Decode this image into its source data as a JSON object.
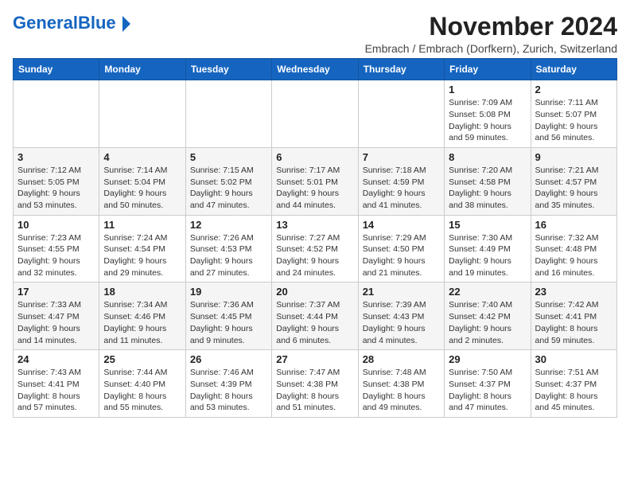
{
  "header": {
    "logo_general": "General",
    "logo_blue": "Blue",
    "title": "November 2024",
    "subtitle": "Embrach / Embrach (Dorfkern), Zurich, Switzerland"
  },
  "weekdays": [
    "Sunday",
    "Monday",
    "Tuesday",
    "Wednesday",
    "Thursday",
    "Friday",
    "Saturday"
  ],
  "weeks": [
    [
      {
        "day": "",
        "info": ""
      },
      {
        "day": "",
        "info": ""
      },
      {
        "day": "",
        "info": ""
      },
      {
        "day": "",
        "info": ""
      },
      {
        "day": "",
        "info": ""
      },
      {
        "day": "1",
        "info": "Sunrise: 7:09 AM\nSunset: 5:08 PM\nDaylight: 9 hours and 59 minutes."
      },
      {
        "day": "2",
        "info": "Sunrise: 7:11 AM\nSunset: 5:07 PM\nDaylight: 9 hours and 56 minutes."
      }
    ],
    [
      {
        "day": "3",
        "info": "Sunrise: 7:12 AM\nSunset: 5:05 PM\nDaylight: 9 hours and 53 minutes."
      },
      {
        "day": "4",
        "info": "Sunrise: 7:14 AM\nSunset: 5:04 PM\nDaylight: 9 hours and 50 minutes."
      },
      {
        "day": "5",
        "info": "Sunrise: 7:15 AM\nSunset: 5:02 PM\nDaylight: 9 hours and 47 minutes."
      },
      {
        "day": "6",
        "info": "Sunrise: 7:17 AM\nSunset: 5:01 PM\nDaylight: 9 hours and 44 minutes."
      },
      {
        "day": "7",
        "info": "Sunrise: 7:18 AM\nSunset: 4:59 PM\nDaylight: 9 hours and 41 minutes."
      },
      {
        "day": "8",
        "info": "Sunrise: 7:20 AM\nSunset: 4:58 PM\nDaylight: 9 hours and 38 minutes."
      },
      {
        "day": "9",
        "info": "Sunrise: 7:21 AM\nSunset: 4:57 PM\nDaylight: 9 hours and 35 minutes."
      }
    ],
    [
      {
        "day": "10",
        "info": "Sunrise: 7:23 AM\nSunset: 4:55 PM\nDaylight: 9 hours and 32 minutes."
      },
      {
        "day": "11",
        "info": "Sunrise: 7:24 AM\nSunset: 4:54 PM\nDaylight: 9 hours and 29 minutes."
      },
      {
        "day": "12",
        "info": "Sunrise: 7:26 AM\nSunset: 4:53 PM\nDaylight: 9 hours and 27 minutes."
      },
      {
        "day": "13",
        "info": "Sunrise: 7:27 AM\nSunset: 4:52 PM\nDaylight: 9 hours and 24 minutes."
      },
      {
        "day": "14",
        "info": "Sunrise: 7:29 AM\nSunset: 4:50 PM\nDaylight: 9 hours and 21 minutes."
      },
      {
        "day": "15",
        "info": "Sunrise: 7:30 AM\nSunset: 4:49 PM\nDaylight: 9 hours and 19 minutes."
      },
      {
        "day": "16",
        "info": "Sunrise: 7:32 AM\nSunset: 4:48 PM\nDaylight: 9 hours and 16 minutes."
      }
    ],
    [
      {
        "day": "17",
        "info": "Sunrise: 7:33 AM\nSunset: 4:47 PM\nDaylight: 9 hours and 14 minutes."
      },
      {
        "day": "18",
        "info": "Sunrise: 7:34 AM\nSunset: 4:46 PM\nDaylight: 9 hours and 11 minutes."
      },
      {
        "day": "19",
        "info": "Sunrise: 7:36 AM\nSunset: 4:45 PM\nDaylight: 9 hours and 9 minutes."
      },
      {
        "day": "20",
        "info": "Sunrise: 7:37 AM\nSunset: 4:44 PM\nDaylight: 9 hours and 6 minutes."
      },
      {
        "day": "21",
        "info": "Sunrise: 7:39 AM\nSunset: 4:43 PM\nDaylight: 9 hours and 4 minutes."
      },
      {
        "day": "22",
        "info": "Sunrise: 7:40 AM\nSunset: 4:42 PM\nDaylight: 9 hours and 2 minutes."
      },
      {
        "day": "23",
        "info": "Sunrise: 7:42 AM\nSunset: 4:41 PM\nDaylight: 8 hours and 59 minutes."
      }
    ],
    [
      {
        "day": "24",
        "info": "Sunrise: 7:43 AM\nSunset: 4:41 PM\nDaylight: 8 hours and 57 minutes."
      },
      {
        "day": "25",
        "info": "Sunrise: 7:44 AM\nSunset: 4:40 PM\nDaylight: 8 hours and 55 minutes."
      },
      {
        "day": "26",
        "info": "Sunrise: 7:46 AM\nSunset: 4:39 PM\nDaylight: 8 hours and 53 minutes."
      },
      {
        "day": "27",
        "info": "Sunrise: 7:47 AM\nSunset: 4:38 PM\nDaylight: 8 hours and 51 minutes."
      },
      {
        "day": "28",
        "info": "Sunrise: 7:48 AM\nSunset: 4:38 PM\nDaylight: 8 hours and 49 minutes."
      },
      {
        "day": "29",
        "info": "Sunrise: 7:50 AM\nSunset: 4:37 PM\nDaylight: 8 hours and 47 minutes."
      },
      {
        "day": "30",
        "info": "Sunrise: 7:51 AM\nSunset: 4:37 PM\nDaylight: 8 hours and 45 minutes."
      }
    ]
  ]
}
